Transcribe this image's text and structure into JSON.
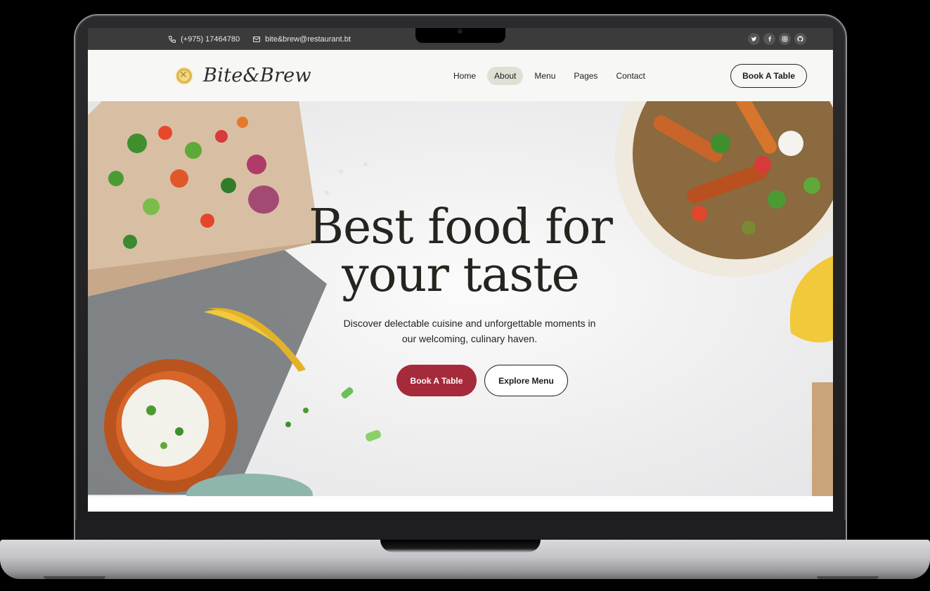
{
  "topbar": {
    "phone": "(+975) 17464780",
    "email": "bite&brew@restaurant.bt",
    "socials": [
      "twitter-icon",
      "facebook-icon",
      "instagram-icon",
      "github-icon"
    ]
  },
  "brand": {
    "name": "Bite&Brew"
  },
  "nav": {
    "items": [
      {
        "label": "Home"
      },
      {
        "label": "About"
      },
      {
        "label": "Menu"
      },
      {
        "label": "Pages"
      },
      {
        "label": "Contact"
      }
    ],
    "active": "About",
    "cta_label": "Book A Table"
  },
  "hero": {
    "title_line1": "Best food for",
    "title_line2": "your taste",
    "subtitle": "Discover delectable cuisine and unforgettable moments in our welcoming, culinary haven.",
    "primary_label": "Book A Table",
    "secondary_label": "Explore Menu"
  },
  "colors": {
    "accent": "#a52a3a",
    "topbar_bg": "#3b3b3b",
    "nav_bg": "#f7f7f5",
    "active_pill": "#dfe0d4"
  }
}
